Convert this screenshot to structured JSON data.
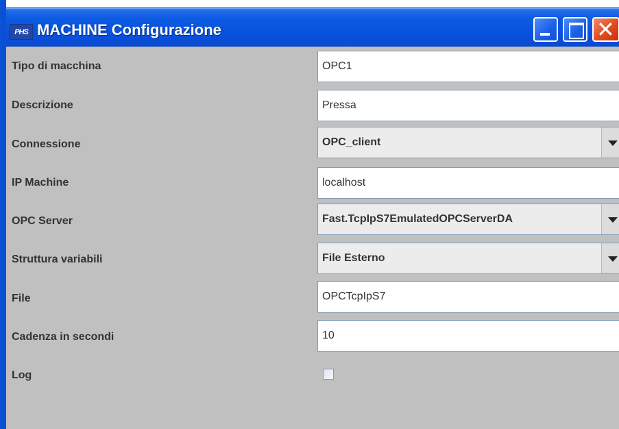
{
  "window": {
    "title": "MACHINE Configurazione",
    "app_icon_text": "PHS",
    "controls": {
      "minimize": "minimize-icon",
      "maximize": "maximize-icon",
      "close": "close-icon"
    }
  },
  "form": {
    "tipo": {
      "label": "Tipo di macchina",
      "value": "OPC1"
    },
    "descrizione": {
      "label": "Descrizione",
      "value": "Pressa"
    },
    "connessione": {
      "label": "Connessione",
      "value": "OPC_client"
    },
    "ip": {
      "label": "IP Machine",
      "value": "localhost"
    },
    "opc_server": {
      "label": "OPC Server",
      "value": "Fast.TcpIpS7EmulatedOPCServerDA"
    },
    "struttura": {
      "label": "Struttura variabili",
      "value": "File Esterno"
    },
    "file": {
      "label": "File",
      "value": "OPCTcpIpS7"
    },
    "cadenza": {
      "label": "Cadenza in secondi",
      "value": "10"
    },
    "log": {
      "label": "Log",
      "checked": false
    }
  },
  "colors": {
    "titlebar": "#0a4dd6",
    "background": "#c0c0c0",
    "close_button": "#e04a1e",
    "field_border": "#7f9db9"
  }
}
